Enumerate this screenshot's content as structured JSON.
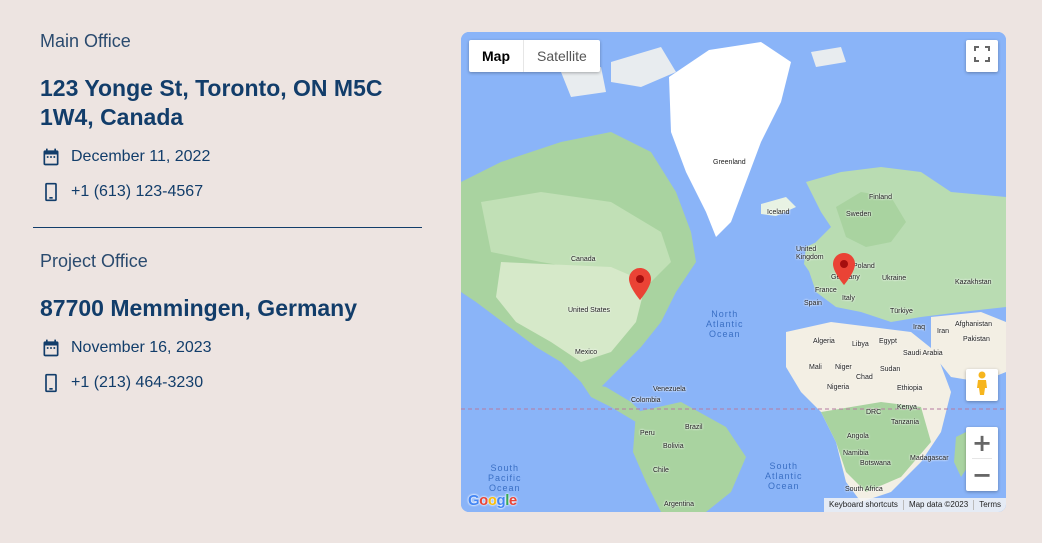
{
  "offices": [
    {
      "label": "Main Office",
      "address": "123 Yonge St, Toronto, ON M5C 1W4, Canada",
      "date": "December 11, 2022",
      "phone": "+1 (613) 123-4567"
    },
    {
      "label": "Project Office",
      "address": "87700 Memmingen, Germany",
      "date": "November 16, 2023",
      "phone": "+1 (213) 464-3230"
    }
  ],
  "icons": {
    "date": "calendar-icon",
    "phone": "smartphone-icon"
  },
  "colors": {
    "background": "#ede4e1",
    "text_primary": "#123d6a",
    "water": "#8ab4f8",
    "land": "#b9dcb2",
    "marker": "#ea4335"
  },
  "map": {
    "type_buttons": {
      "map": "Map",
      "satellite": "Satellite"
    },
    "active_type": "Map",
    "zoom_in": "+",
    "zoom_out": "−",
    "attribution": {
      "shortcuts": "Keyboard shortcuts",
      "data": "Map data ©2023",
      "terms": "Terms"
    },
    "logo": "Google",
    "labels": {
      "greenland": "Greenland",
      "iceland": "Iceland",
      "finland": "Finland",
      "sweden": "Sweden",
      "uk": "United Kingdom",
      "poland": "Poland",
      "germany": "Germany",
      "ukraine": "Ukraine",
      "france": "France",
      "spain": "Spain",
      "italy": "Italy",
      "kazakhstan": "Kazakhstan",
      "turkiye": "Türkiye",
      "iraq": "Iraq",
      "iran": "Iran",
      "afghanistan": "Afghanistan",
      "pakistan": "Pakistan",
      "algeria": "Algeria",
      "libya": "Libya",
      "egypt": "Egypt",
      "saudi": "Saudi Arabia",
      "mali": "Mali",
      "niger": "Niger",
      "chad": "Chad",
      "sudan": "Sudan",
      "nigeria": "Nigeria",
      "ethiopia": "Ethiopia",
      "drc": "DRC",
      "kenya": "Kenya",
      "tanzania": "Tanzania",
      "angola": "Angola",
      "namibia": "Namibia",
      "botswana": "Botswana",
      "madagascar": "Madagascar",
      "south_africa": "South Africa",
      "canada": "Canada",
      "usa": "United States",
      "mexico": "Mexico",
      "venezuela": "Venezuela",
      "colombia": "Colombia",
      "brazil": "Brazil",
      "peru": "Peru",
      "bolivia": "Bolivia",
      "chile": "Chile",
      "argentina": "Argentina"
    },
    "oceans": {
      "north_atlantic": "North\nAtlantic\nOcean",
      "south_pacific": "South\nPacific\nOcean",
      "south_atlantic": "South\nAtlantic\nOcean"
    }
  }
}
